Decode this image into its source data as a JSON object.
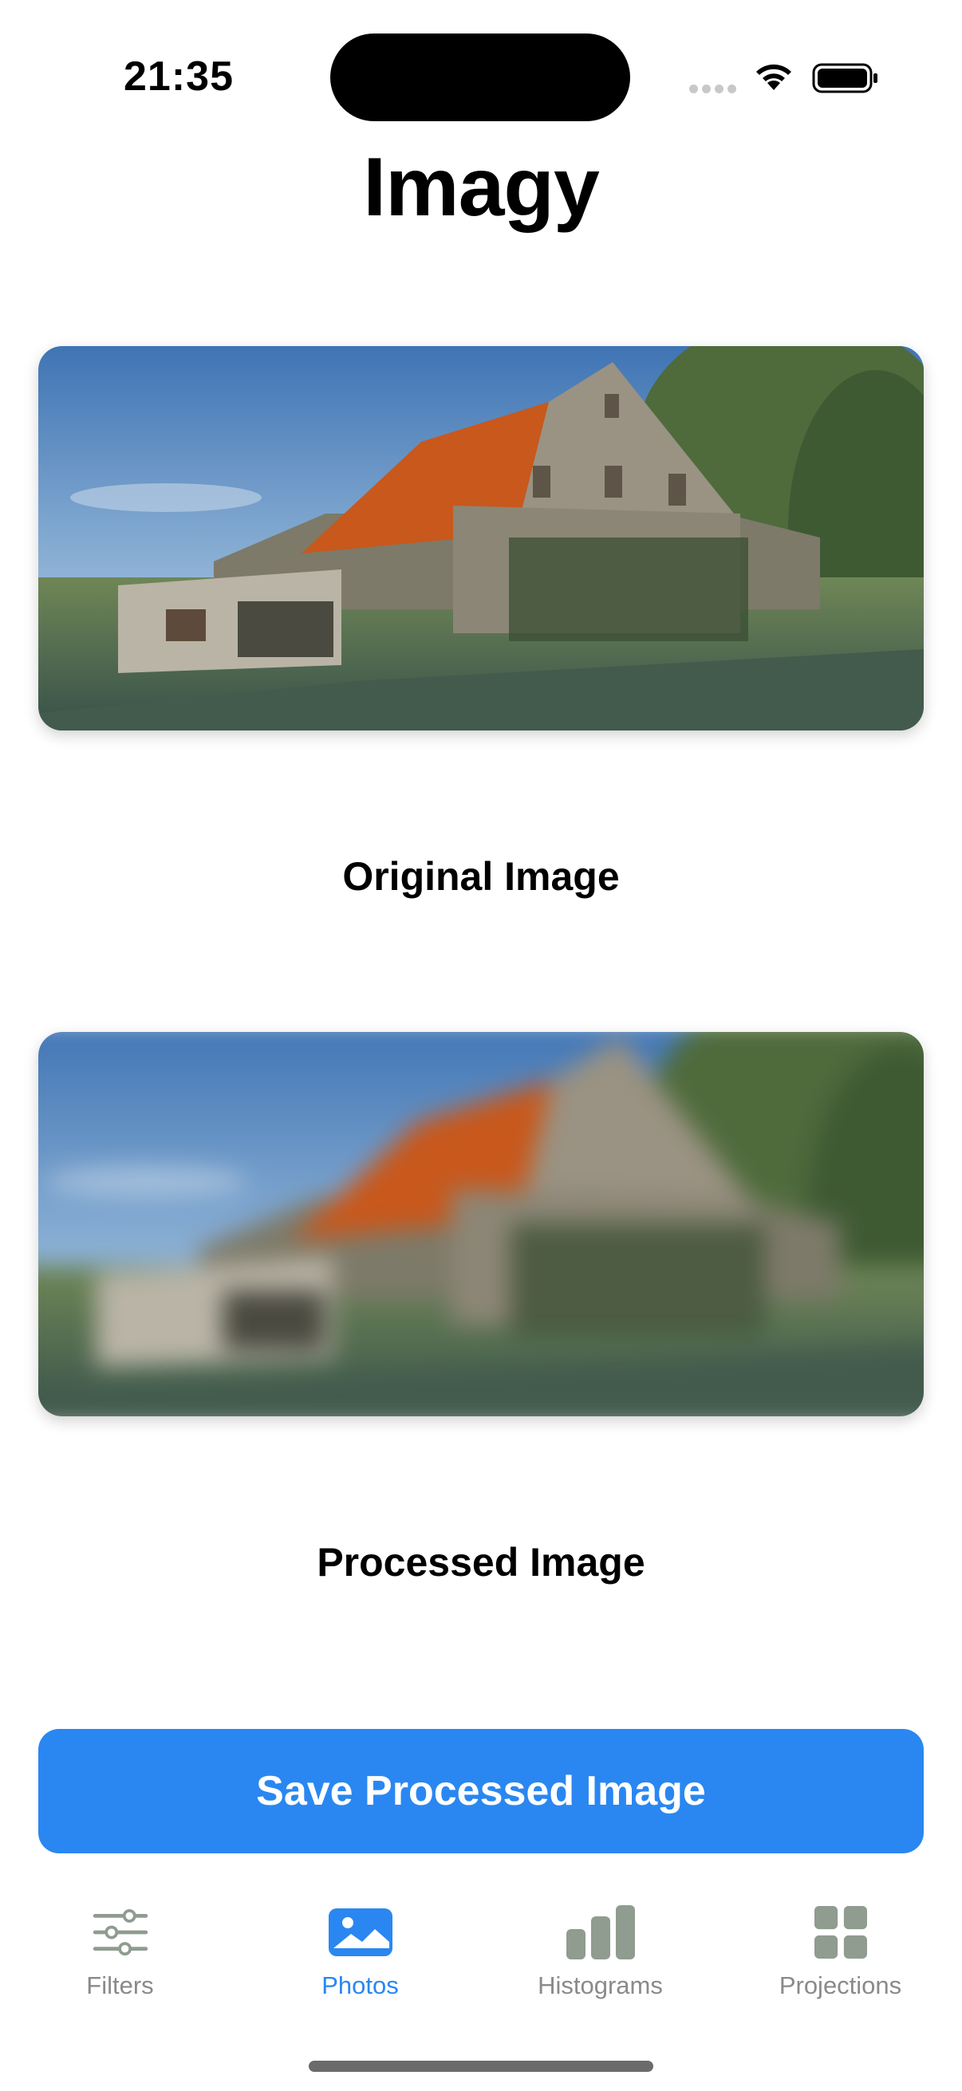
{
  "status_bar": {
    "time": "21:35",
    "icons": [
      "cellular-signal-icon",
      "wifi-icon",
      "battery-icon"
    ]
  },
  "app": {
    "title": "Imagy"
  },
  "images": {
    "original_caption": "Original Image",
    "processed_caption": "Processed Image"
  },
  "actions": {
    "save_label": "Save Processed Image"
  },
  "tab_bar": {
    "tabs": [
      {
        "label": "Filters",
        "icon": "sliders-icon",
        "active": false
      },
      {
        "label": "Photos",
        "icon": "photo-icon",
        "active": true
      },
      {
        "label": "Histograms",
        "icon": "bar-chart-icon",
        "active": false
      },
      {
        "label": "Projections",
        "icon": "grid-icon",
        "active": false
      }
    ]
  },
  "colors": {
    "accent": "#2a87f1",
    "inactive": "#8a8a8a",
    "inactive_icon": "#8f9c8f"
  }
}
